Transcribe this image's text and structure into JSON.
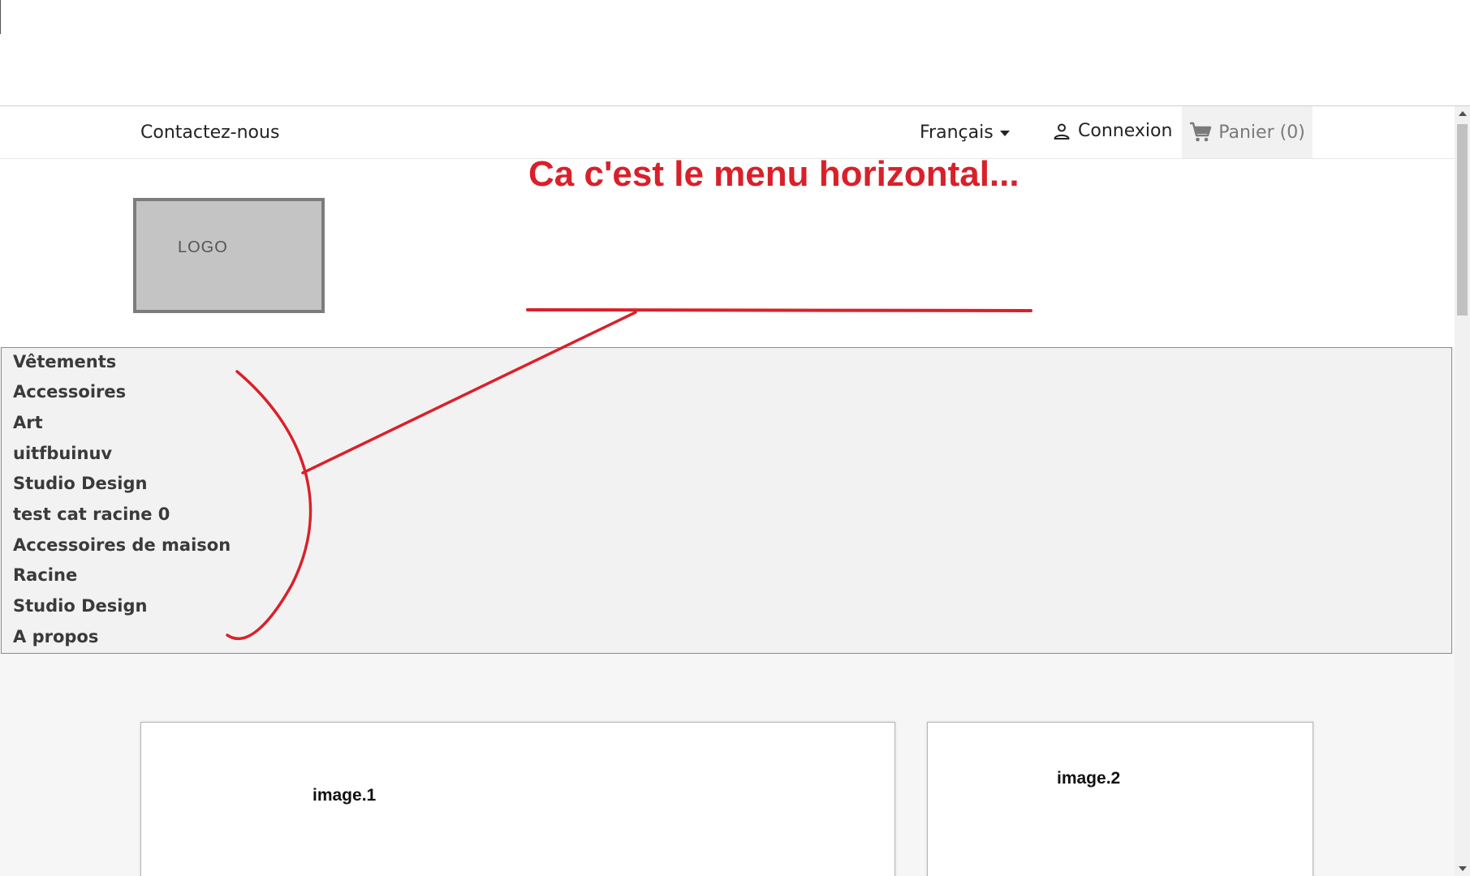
{
  "nav": {
    "contact": "Contactez-nous",
    "language": "Français",
    "login": "Connexion",
    "cart": "Panier (0)"
  },
  "header": {
    "logo_text": "LOGO"
  },
  "annotation": {
    "text": "Ca c'est le menu horizontal...",
    "color": "#d9202a"
  },
  "menu": {
    "items": [
      "Vêtements",
      "Accessoires",
      "Art",
      "uitfbuinuv",
      "Studio Design",
      "test cat racine 0",
      "Accessoires de maison",
      "Racine",
      "Studio Design",
      "A propos"
    ]
  },
  "content": {
    "image1_label": "image.1",
    "image2_label": "image.2"
  }
}
